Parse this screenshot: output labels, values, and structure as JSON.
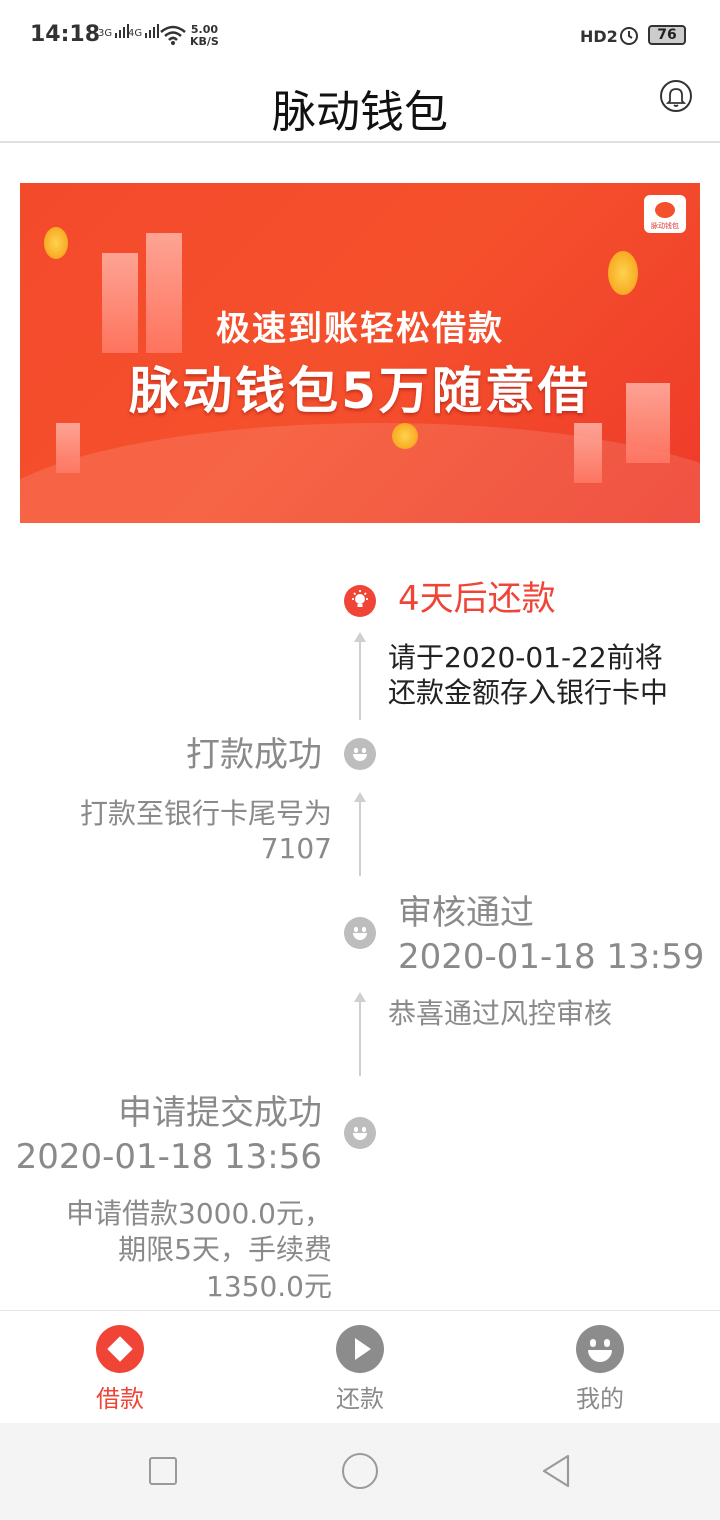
{
  "status_bar": {
    "time": "14:18",
    "sig1": "3G",
    "sig2": "4G",
    "speed_value": "5.00",
    "speed_unit": "KB/S",
    "hd": "HD2",
    "battery": "76"
  },
  "header": {
    "title": "脉动钱包",
    "bell_icon": "bell-icon"
  },
  "banner": {
    "line1": "极速到账轻松借款",
    "line2": "脉动钱包5万随意借",
    "logo_text": "脉动钱包",
    "background_color": "#f4502c"
  },
  "timeline": {
    "steps": [
      {
        "title": "4天后还款",
        "desc": "请于2020-01-22前将\n还款金额存入银行卡中",
        "icon": "lightbulb-icon",
        "active": true,
        "color": "#f04437"
      },
      {
        "title": "打款成功",
        "desc": "打款至银行卡尾号为\n7107",
        "icon": "smile-icon",
        "active": false
      },
      {
        "title": "审核通过",
        "time": "2020-01-18 13:59",
        "desc": "恭喜通过风控审核",
        "icon": "smile-icon",
        "active": false
      },
      {
        "title": "申请提交成功",
        "time": "2020-01-18 13:56",
        "desc": "申请借款3000.0元，\n期限5天，手续费\n1350.0元",
        "icon": "smile-icon",
        "active": false
      }
    ]
  },
  "tabbar": {
    "tabs": [
      {
        "label": "借款",
        "icon": "diamond-icon",
        "active": true
      },
      {
        "label": "还款",
        "icon": "play-icon",
        "active": false
      },
      {
        "label": "我的",
        "icon": "smiley-icon",
        "active": false
      }
    ],
    "active_color": "#f04437",
    "inactive_color": "#8c8c8c"
  },
  "navbar": {
    "recent_icon": "square-icon",
    "home_icon": "circle-icon",
    "back_icon": "back-triangle-icon"
  }
}
